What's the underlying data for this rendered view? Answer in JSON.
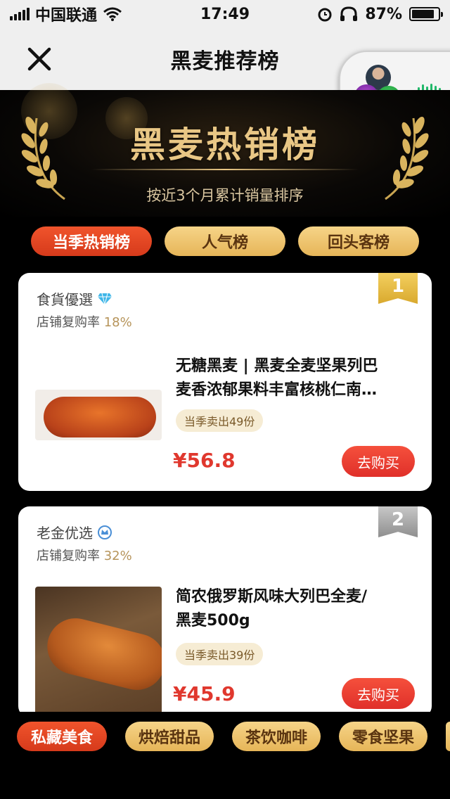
{
  "status_bar": {
    "carrier": "中国联通",
    "time": "17:49",
    "battery_percent": "87%",
    "battery_level": 0.87
  },
  "nav": {
    "title": "黑麦推荐榜",
    "close_icon": "close-icon"
  },
  "hero": {
    "title": "黑麦热销榜",
    "subtitle": "按近3个月累计销量排序"
  },
  "tabs": [
    {
      "label": "当季热销榜",
      "active": true
    },
    {
      "label": "人气榜",
      "active": false
    },
    {
      "label": "回头客榜",
      "active": false
    }
  ],
  "products": [
    {
      "rank": "1",
      "shop": "食貨優選",
      "shop_icon": "diamond-icon",
      "repurchase_label": "店铺复购率",
      "repurchase_rate": "18%",
      "title_line1": "无糖黑麦 | 黑麦全麦坚果列巴",
      "title_line2": "麦香浓郁果料丰富核桃仁南…",
      "sold": "当季卖出49份",
      "price": "¥56.8",
      "buy_label": "去购买"
    },
    {
      "rank": "2",
      "shop": "老金优选",
      "shop_icon": "crown-icon",
      "repurchase_label": "店铺复购率",
      "repurchase_rate": "32%",
      "title_line1": "简农俄罗斯风味大列巴全麦/",
      "title_line2": "黑麦500g",
      "sold": "当季卖出39份",
      "price": "¥45.9",
      "buy_label": "去购买"
    }
  ],
  "categories": [
    {
      "label": "私藏美食",
      "active": true
    },
    {
      "label": "烘焙甜品",
      "active": false
    },
    {
      "label": "茶饮咖啡",
      "active": false
    },
    {
      "label": "零食坚果",
      "active": false
    }
  ],
  "colors": {
    "accent_red": "#e0382e",
    "gold": "#e9c785",
    "tab_gold": "#e6b558"
  }
}
